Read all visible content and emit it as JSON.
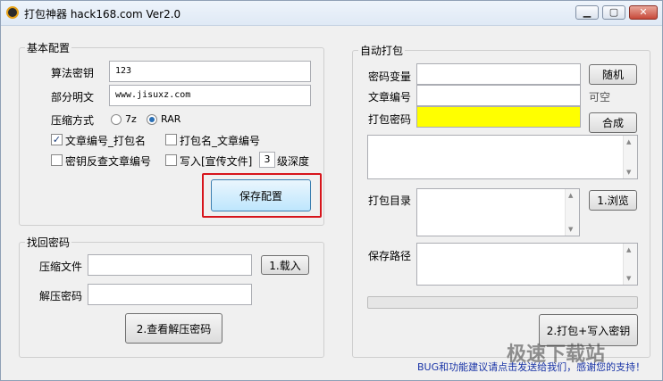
{
  "window": {
    "title": "打包神器 hack168.com Ver2.0"
  },
  "basic": {
    "legend": "基本配置",
    "algorithm_key_label": "算法密钥",
    "algorithm_key_value": "123",
    "plaintext_label": "部分明文",
    "plaintext_value": "www.jisuxz.com",
    "compression_label": "压缩方式",
    "opt_7z": "7z",
    "opt_rar": "RAR",
    "cb1": "文章编号_打包名",
    "cb2": "打包名_文章编号",
    "cb3": "密钥反查文章编号",
    "cb4": "写入[宣传文件]",
    "depth_value": "3",
    "depth_label": "级深度",
    "save_button": "保存配置"
  },
  "recover": {
    "legend": "找回密码",
    "archive_label": "压缩文件",
    "archive_value": "",
    "load_button": "1.载入",
    "unzip_label": "解压密码",
    "unzip_value": "",
    "view_button": "2.查看解压密码"
  },
  "auto": {
    "legend": "自动打包",
    "var_label": "密码变量",
    "var_value": "",
    "random_button": "随机",
    "article_label": "文章编号",
    "article_value": "",
    "optional_text": "可空",
    "pack_pwd_label": "打包密码",
    "pack_pwd_value": "",
    "compose_button": "合成",
    "dir_label": "打包目录",
    "browse_button": "1.浏览",
    "save_path_label": "保存路径",
    "pack_button": "2.打包+写入密钥"
  },
  "footer": "BUG和功能建议请点击发送给我们，感谢您的支持！",
  "watermark": "极速下载站"
}
